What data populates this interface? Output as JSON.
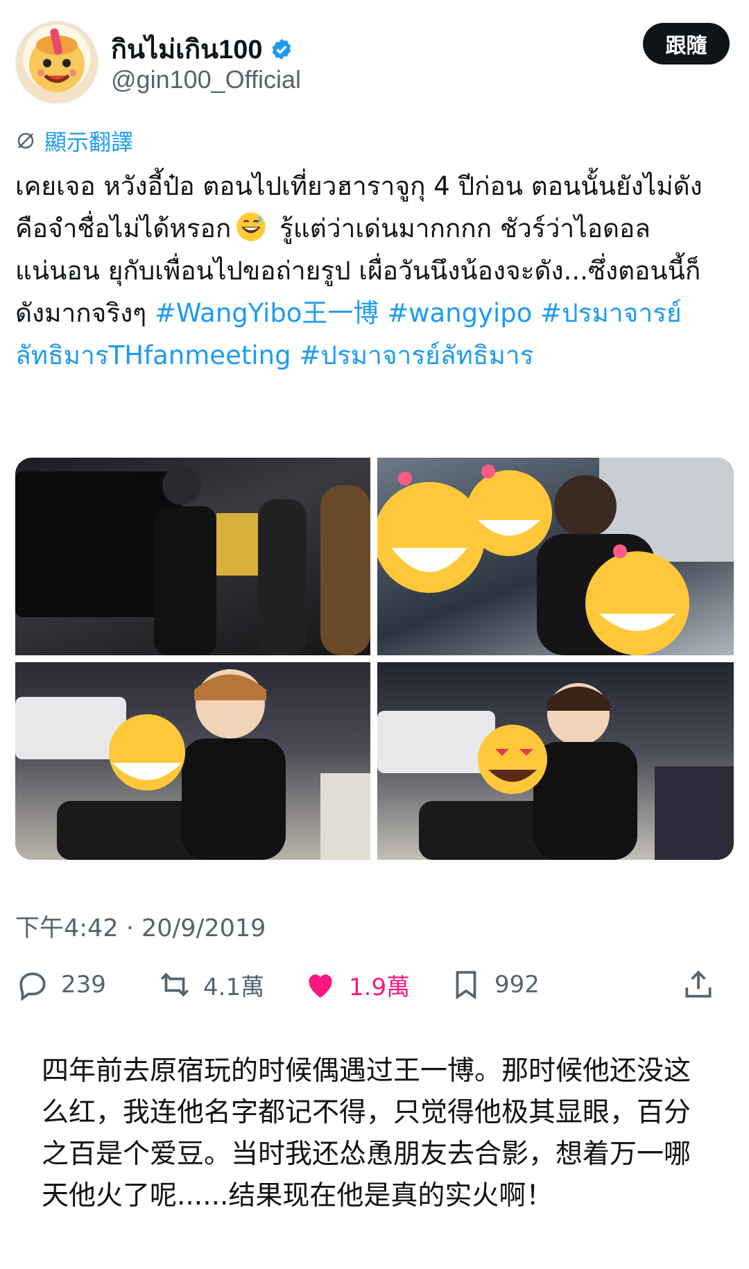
{
  "post": {
    "author": {
      "display_name": "กินไม่เกิน100",
      "handle": "@gin100_Official",
      "verified": true,
      "avatar_icon": "cartoon-mascot-avatar"
    },
    "follow_label": "跟隨",
    "translate_label": "顯示翻譯",
    "text": {
      "line1": "เคยเจอ หวังอี้ป๋อ ตอนไปเที่ยวฮาราจูกุ 4 ปีก่อน ตอนนั้นยังไม่ดัง คือจำชื่อไม่ได้หรอก",
      "line2": " รู้แต่ว่าเด่นมากกกก ชัวร์ว่าไอดอลแน่นอน ยุกับเพื่อนไปขอถ่ายรูป เผื่อวันนึงน้องจะดัง...ซึ่งตอนนี้ก็ดังมากจริงๆ ",
      "hashtags": [
        "#WangYibo王一博",
        "#wangyipo",
        "#ปรมาจารย์ลัทธิมารTHfanmeeting",
        "#ปรมาจารย์ลัทธิมาร"
      ]
    },
    "timestamp": "下午4:42 · 20/9/2019",
    "stats": {
      "replies": "239",
      "reposts": "4.1萬",
      "likes": "1.9萬",
      "bookmarks": "992"
    }
  },
  "colors": {
    "accent": "#1d9bf0",
    "like": "#f91880",
    "muted": "#536471",
    "text": "#0f1419"
  },
  "translation_text": "四年前去原宿玩的时候偶遇过王一博。那时候他还没这么红，我连他名字都记不得，只觉得他极其显眼，百分之百是个爱豆。当时我还怂恿朋友去合影，想着万一哪天他火了呢......结果现在他是真的实火啊！"
}
